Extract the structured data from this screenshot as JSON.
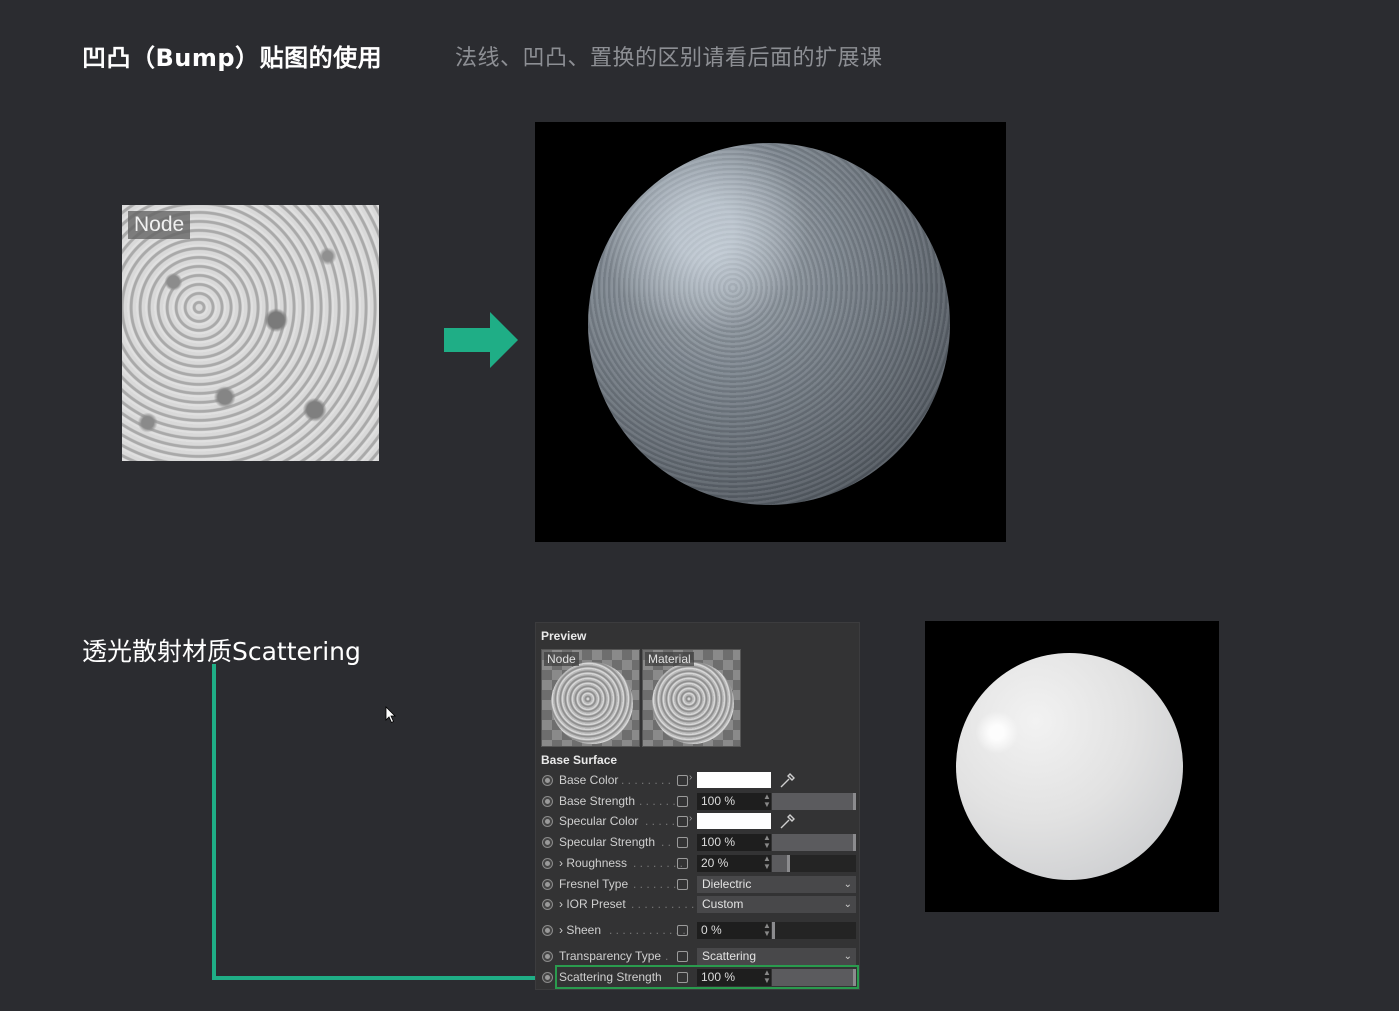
{
  "titles": {
    "bump": "凹凸（Bump）贴图的使用",
    "note": "法线、凹凸、置换的区别请看后面的扩展课",
    "scattering": "透光散射材质Scattering"
  },
  "bump_node": {
    "tag": "Node"
  },
  "colors": {
    "accent": "#1fae86",
    "highlight": "#2a9b4e",
    "background": "#2b2c30"
  },
  "panel": {
    "preview_heading": "Preview",
    "thumbnails": [
      {
        "label": "Node"
      },
      {
        "label": "Material"
      }
    ],
    "section_heading": "Base Surface",
    "rows": {
      "base_color": {
        "label": "Base Color",
        "dots": ". . . . . . . .",
        "swatch": "#ffffff"
      },
      "base_strength": {
        "label": "Base Strength",
        "dots": ". . . . . .",
        "value": "100 %",
        "level": 1.0
      },
      "specular_color": {
        "label": "Specular Color",
        "dots": ". . . . .",
        "swatch": "#ffffff"
      },
      "specular_strength": {
        "label": "Specular Strength",
        "dots": ". .",
        "value": "100 %",
        "level": 1.0
      },
      "roughness": {
        "label": "› Roughness",
        "dots": ". . . . . . . .",
        "value": "20 %",
        "level": 0.2
      },
      "fresnel_type": {
        "label": "Fresnel Type",
        "dots": ". . . . . . .",
        "value": "Dielectric"
      },
      "ior_preset": {
        "label": "› IOR Preset",
        "dots": ". . . . . . . . . .",
        "value": "Custom"
      },
      "sheen": {
        "label": "› Sheen",
        "dots": ". . . . . . . . . . . .",
        "value": "0 %",
        "level": 0.0
      },
      "transparency_type": {
        "label": "Transparency Type",
        "dots": ".",
        "value": "Scattering"
      },
      "scattering_strength": {
        "label": "Scattering Strength",
        "value": "100 %",
        "level": 1.0
      }
    }
  }
}
